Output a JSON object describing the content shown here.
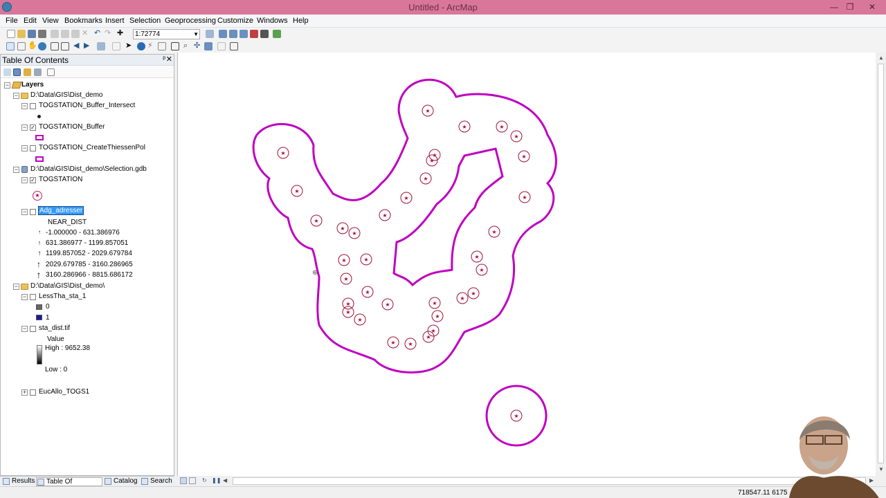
{
  "window": {
    "title": "Untitled - ArcMap",
    "minimize": "—",
    "restore": "❐",
    "close": "✕"
  },
  "menu": [
    "File",
    "Edit",
    "View",
    "Bookmarks",
    "Insert",
    "Selection",
    "Geoprocessing",
    "Customize",
    "Windows",
    "Help"
  ],
  "toolbar": {
    "scale_value": "1:72774"
  },
  "toc": {
    "title": "Table Of Contents",
    "pin": "ᵖ",
    "close": "✕",
    "root": "Layers",
    "groups": {
      "g1": "D:\\Data\\GIS\\Dist_demo",
      "g2": "D:\\Data\\GIS\\Dist_demo\\Selection.gdb",
      "g3": "D:\\Data\\GIS\\Dist_demo\\"
    },
    "layers": {
      "buffer_intersect": "TOGSTATION_Buffer_Intersect",
      "buffer": "TOGSTATION_Buffer",
      "thiessen": "TOGSTATION_CreateThiessenPol",
      "togstation": "TOGSTATION",
      "adg": "Adg_adresser",
      "adg_field": "NEAR_DIST",
      "lessthan": "LessTha_sta_1",
      "sta_dist": "sta_dist.tif",
      "eucallo": "EucAllo_TOGS1"
    },
    "adg_classes": [
      "-1.000000 - 631.386976",
      "631.386977 - 1199.857051",
      "1199.857052 - 2029.679784",
      "2029.679785 - 3160.286965",
      "3160.286966 - 8815.686172"
    ],
    "lessthan_values": [
      "0",
      "1"
    ],
    "raster": {
      "value_label": "Value",
      "high": "High : 9652.38",
      "low": "Low : 0"
    },
    "tabs": [
      "Results",
      "Table Of Contents",
      "Catalog",
      "Search"
    ]
  },
  "status": {
    "coords": "718547.11  6175"
  },
  "colors": {
    "buffer_outline": "#c000c0",
    "station_marker": "#a0103a",
    "titlebar": "#d9779a",
    "selection": "#3399ff"
  }
}
